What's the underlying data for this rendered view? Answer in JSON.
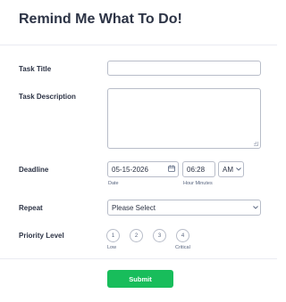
{
  "form": {
    "title": "Remind Me What To Do!"
  },
  "task_title": {
    "label": "Task Title",
    "value": ""
  },
  "task_description": {
    "label": "Task Description",
    "value": ""
  },
  "deadline": {
    "label": "Deadline",
    "date_value": "05-15-2026",
    "date_sublabel": "Date",
    "time_value": "06:28",
    "time_sublabel": "Hour Minutes",
    "ampm_value": "AM",
    "calendar_icon": "calendar-icon",
    "chevron_icon": "chevron-down-icon"
  },
  "repeat": {
    "label": "Repeat",
    "selected": "Please Select",
    "chevron_icon": "chevron-down-icon"
  },
  "priority": {
    "label": "Priority Level",
    "options": [
      "1",
      "2",
      "3",
      "4"
    ],
    "low_label": "Low",
    "critical_label": "Critical"
  },
  "submit_label": "Submit",
  "colors": {
    "accent": "#18bd5b",
    "text": "#2c3345",
    "border": "#b8bdc9"
  }
}
